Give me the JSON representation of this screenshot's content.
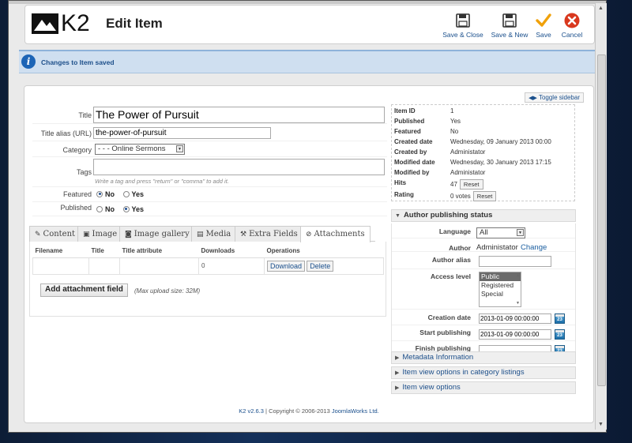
{
  "app": {
    "brand": "K2",
    "title": "Edit Item"
  },
  "toolbar": {
    "save_close": "Save & Close",
    "save_new": "Save & New",
    "save": "Save",
    "cancel": "Cancel"
  },
  "message": {
    "text": "Changes to Item saved"
  },
  "sidebar_toggle": "Toggle sidebar",
  "form": {
    "title_label": "Title",
    "title_value": "The Power of Pursuit",
    "alias_label": "Title alias (URL)",
    "alias_value": "the-power-of-pursuit",
    "category_label": "Category",
    "category_value": "- - - Online Sermons",
    "tags_label": "Tags",
    "tags_hint": "Write a tag and press \"return\" or \"comma\" to add it.",
    "featured_label": "Featured",
    "published_label": "Published",
    "no": "No",
    "yes": "Yes"
  },
  "tabs": [
    {
      "label": "Content",
      "icon": "edit-icon"
    },
    {
      "label": "Image",
      "icon": "image-icon"
    },
    {
      "label": "Image gallery",
      "icon": "camera-icon"
    },
    {
      "label": "Media",
      "icon": "film-icon"
    },
    {
      "label": "Extra Fields",
      "icon": "wrench-icon"
    },
    {
      "label": "Attachments",
      "icon": "paperclip-icon"
    }
  ],
  "attachments": {
    "columns": [
      "Filename",
      "Title",
      "Title attribute",
      "Downloads",
      "Operations"
    ],
    "row": {
      "downloads": "0",
      "download": "Download",
      "delete": "Delete"
    },
    "add_button": "Add attachment field",
    "max_upload": "(Max upload size: 32M)"
  },
  "meta": [
    {
      "k": "Item ID",
      "v": "1"
    },
    {
      "k": "Published",
      "v": "Yes"
    },
    {
      "k": "Featured",
      "v": "No"
    },
    {
      "k": "Created date",
      "v": "Wednesday, 09 January 2013 00:00"
    },
    {
      "k": "Created by",
      "v": "Administator"
    },
    {
      "k": "Modified date",
      "v": "Wednesday, 30 January 2013 17:15"
    },
    {
      "k": "Modified by",
      "v": "Administator"
    },
    {
      "k": "Hits",
      "v": "47"
    },
    {
      "k": "Rating",
      "v": "0 votes"
    }
  ],
  "meta_reset": "Reset",
  "author_publishing": {
    "header": "Author publishing status",
    "language_label": "Language",
    "language_value": "All",
    "author_label": "Author",
    "author_value": "Administator",
    "change": "Change",
    "alias_label": "Author alias",
    "access_label": "Access level",
    "access_options": [
      "Public",
      "Registered",
      "Special"
    ],
    "creation_label": "Creation date",
    "creation_value": "2013-01-09 00:00:00",
    "start_label": "Start publishing",
    "start_value": "2013-01-09 00:00:00",
    "finish_label": "Finish publishing",
    "finish_value": "",
    "calendar_day": "23"
  },
  "sections": {
    "metadata": "Metadata Information",
    "category_listings": "Item view options in category listings",
    "item_view": "Item view options"
  },
  "footer": {
    "version": "K2 v2.6.3",
    "copyright": "| Copyright © 2006-2013",
    "company": "JoomlaWorks Ltd."
  }
}
